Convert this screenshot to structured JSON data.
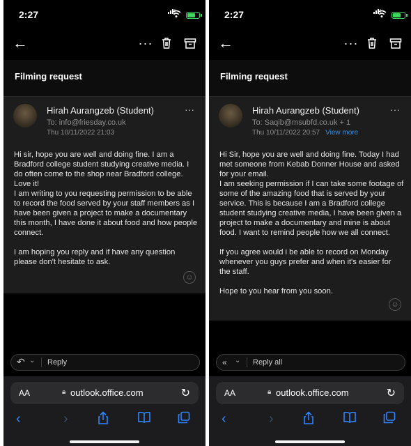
{
  "left": {
    "status": {
      "time": "2:27"
    },
    "subject": "Filming request",
    "sender": "Hirah Aurangzeb (Student)",
    "to": "To: info@friesday.co.uk",
    "date": "Thu 10/11/2022 21:03",
    "body": [
      "Hi sir, hope you are well and doing fine. I am a Bradford college student studying creative media. I do often come to the shop near Bradford college. Love it!",
      "I am writing to you requesting permission to be able to record the food served by your staff members as I have been given a project to make a documentary this month, I have done it about food and how people connect.",
      "",
      "I am hoping you reply and if have any question please don't hesitate to ask."
    ],
    "reply_label": "Reply",
    "url": "outlook.office.com",
    "aa": "AA"
  },
  "right": {
    "status": {
      "time": "2:27"
    },
    "subject": "Filming request",
    "sender": "Hirah Aurangzeb (Student)",
    "to": "To: Saqib@msubfd.co.uk  + 1",
    "date": "Thu 10/11/2022 20:57",
    "view_more": "View more",
    "body": [
      "Hi Sir, hope you are well and doing fine. Today I had met someone from Kebab Donner House and asked for your email.",
      "I am seeking permission if I can take some footage of some of the amazing food that is served by your service. This is because I am a Bradford college student studying creative media, I have been given a project to make a documentary and mine is about food. I want to remind people how we all connect.",
      "",
      "If you agree would i be able to record on Monday whenever you guys prefer and when it's easier for the staff.",
      "",
      "Hope to you hear from you soon."
    ],
    "reply_label": "Reply all",
    "url": "outlook.office.com",
    "aa": "AA"
  },
  "colors": {
    "accent": "#2f84ff",
    "battery": "#3ed65d",
    "link": "#3b8fe0"
  },
  "icons": [
    "back-arrow-icon",
    "more-icon",
    "trash-icon",
    "archive-icon",
    "emoji-icon",
    "reply-icon",
    "reply-all-icon",
    "lock-icon",
    "reload-icon",
    "share-icon",
    "bookmarks-icon",
    "tabs-icon"
  ]
}
